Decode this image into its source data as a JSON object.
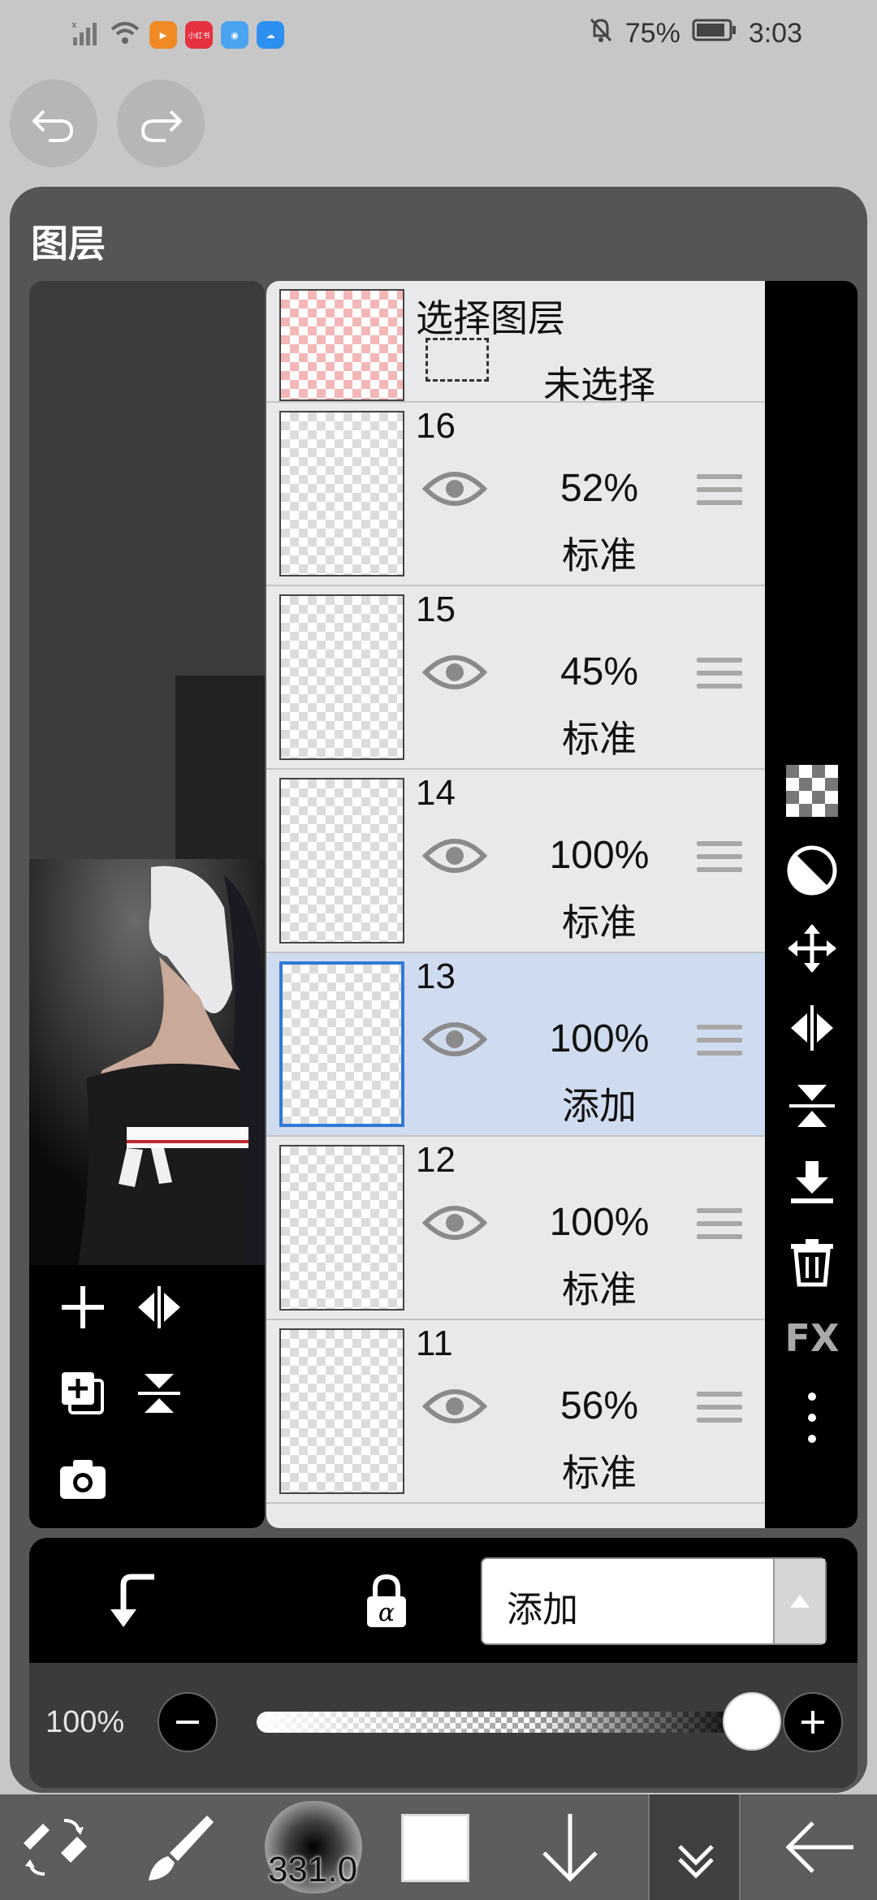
{
  "status_bar": {
    "battery": "75%",
    "time": "3:03",
    "app_badges": [
      {
        "name": "video-app",
        "text": "▶",
        "color": "#f08a24"
      },
      {
        "name": "xiaohongshu-app",
        "text": "小红书",
        "color": "#e5303e"
      },
      {
        "name": "browser-app",
        "text": "◉",
        "color": "#4aa3f0"
      },
      {
        "name": "weather-app",
        "text": "☁",
        "color": "#2d8ff0"
      }
    ]
  },
  "panel": {
    "title": "图层",
    "selection_layer": {
      "title": "选择图层",
      "status": "未选择"
    },
    "layers": [
      {
        "number": "16",
        "opacity": "52%",
        "mode": "标准"
      },
      {
        "number": "15",
        "opacity": "45%",
        "mode": "标准"
      },
      {
        "number": "14",
        "opacity": "100%",
        "mode": "标准"
      },
      {
        "number": "13",
        "opacity": "100%",
        "mode": "添加",
        "selected": true
      },
      {
        "number": "12",
        "opacity": "100%",
        "mode": "标准"
      },
      {
        "number": "11",
        "opacity": "56%",
        "mode": "标准"
      }
    ],
    "right_tools": [
      "checker-icon",
      "half-circle-icon",
      "move-icon",
      "flip-horizontal-icon",
      "flip-vertical-icon",
      "merge-down-icon",
      "trash-icon",
      "fx-icon",
      "more-vertical-icon"
    ],
    "fx_label": "FX",
    "blend_mode": "添加",
    "opacity_label": "100%",
    "opacity_value": 1.0
  },
  "toolbar": {
    "brush_size": "331.0",
    "current_color": "#ffffff"
  },
  "colors": {
    "selected_row": "#cfdcef",
    "panel_bg": "#555555",
    "accent": "#2f7ad6"
  }
}
